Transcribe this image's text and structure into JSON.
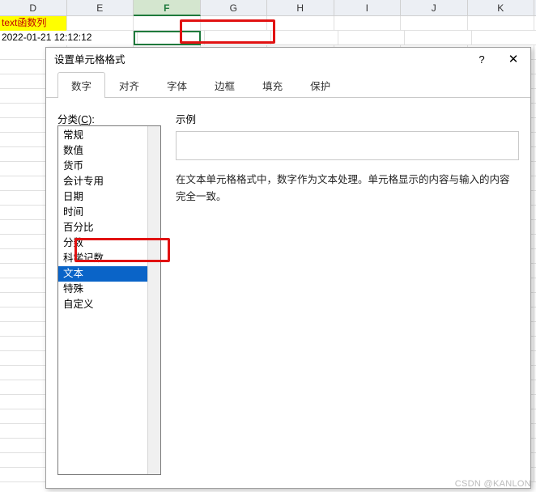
{
  "columns": [
    "D",
    "E",
    "F",
    "G",
    "H",
    "I",
    "J",
    "K"
  ],
  "selectedColumn": "F",
  "cells": {
    "D1": "text函数列",
    "D2": "2022-01-21 12:12:12"
  },
  "dialog": {
    "title": "设置单元格格式",
    "tabs": [
      "数字",
      "对齐",
      "字体",
      "边框",
      "填充",
      "保护"
    ],
    "activeTab": "数字",
    "category_label_prefix": "分类(",
    "category_label_hotkey": "C",
    "category_label_suffix": "):",
    "categories": [
      "常规",
      "数值",
      "货币",
      "会计专用",
      "日期",
      "时间",
      "百分比",
      "分数",
      "科学记数",
      "文本",
      "特殊",
      "自定义"
    ],
    "selectedCategory": "文本",
    "sample_label": "示例",
    "description": "在文本单元格格式中，数字作为文本处理。单元格显示的内容与输入的内容完全一致。"
  },
  "watermark": "CSDN @KANLON"
}
